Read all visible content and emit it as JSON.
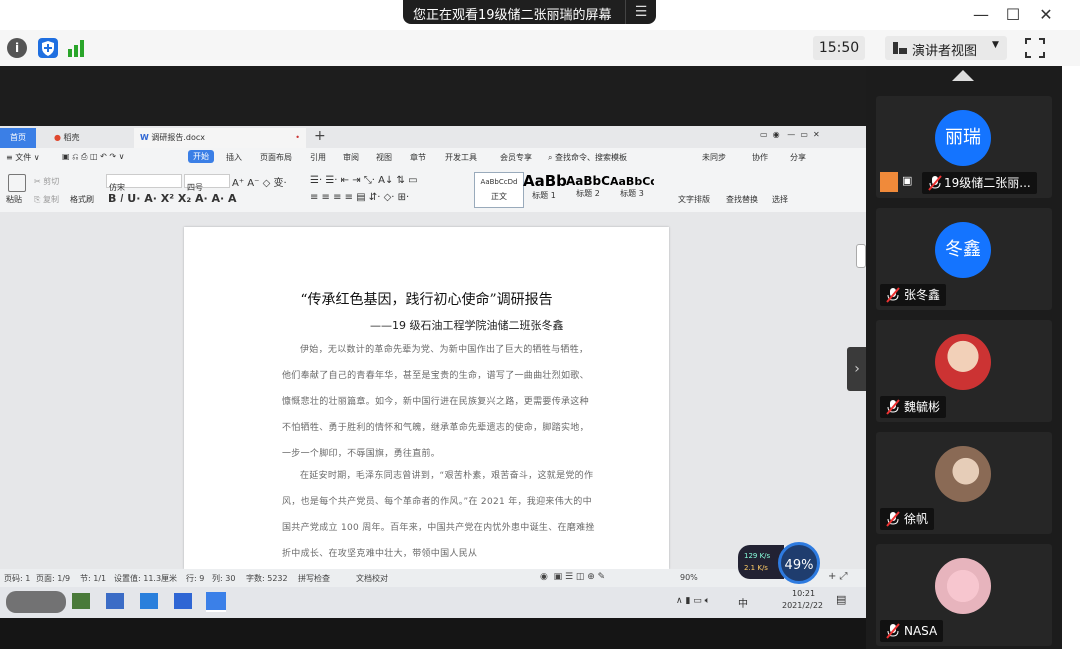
{
  "window": {
    "share_banner": "您正在观看19级储二张丽瑞的屏幕",
    "controls": [
      "—",
      "☐",
      "✕"
    ]
  },
  "toolbar": {
    "time": "15:50",
    "presenter_view": "演讲者视图",
    "icons": [
      "info-icon",
      "shield-icon",
      "signal-icon",
      "fullscreen-icon"
    ]
  },
  "wps": {
    "tabs": {
      "home": "首页",
      "docer": "稻壳",
      "doc": "调研报告.docx"
    },
    "menu": [
      "≡ 文件 ∨",
      "开始",
      "插入",
      "页面布局",
      "引用",
      "审阅",
      "视图",
      "章节",
      "开发工具",
      "会员专享",
      "查找命令、搜索模板",
      "未同步",
      "协作",
      "分享"
    ],
    "ribbon": {
      "paste": "粘贴",
      "cut": "剪切",
      "copy": "复制",
      "format_painter": "格式刷",
      "font": "仿宋",
      "size": "四号",
      "styles": [
        {
          "sample": "AaBbCcDd",
          "name": "正文"
        },
        {
          "sample": "AaBb",
          "name": "标题 1"
        },
        {
          "sample": "AaBbC",
          "name": "标题 2"
        },
        {
          "sample": "AaBbCc",
          "name": "标题 3"
        }
      ],
      "text_layout": "文字排版",
      "find_replace": "查找替换",
      "select": "选择"
    },
    "document": {
      "title": "“传承红色基因，践行初心使命”调研报告",
      "subtitle": "——19 级石油工程学院油储二班张冬鑫",
      "paragraphs": [
        "伊始，无以数计的革命先辈为党、为新中国作出了巨大的牺牲与牺牲，他们奉献了自己的青春年华，甚至是宝贵的生命，谱写了一曲曲壮烈如歌、慷慨悲壮的壮丽篇章。如今，新中国行进在民族复兴之路，更需要传承这种不怕牺牲、勇于胜利的情怀和气魄，继承革命先辈遗志的使命，脚踏实地，一步一个脚印，不辱国旗，勇往直前。",
        "在延安时期，毛泽东同志曾讲到，“艰苦朴素，艰苦奋斗，这就是党的作风，也是每个共产党员、每个革命者的作风。”在 2021 年，我迎来伟大的中国共产党成立 100 周年。百年来，中国共产党在内忧外患中诞生、在磨难挫折中成长、在攻坚克难中壮大，带领中国人民从"
      ]
    },
    "status": [
      "页码: 1",
      "页面: 1/9",
      "节: 1/1",
      "设置值: 11.3厘米",
      "行: 9",
      "列: 30",
      "字数: 5232",
      "拼写检查",
      "文档校对",
      "90%"
    ],
    "taskbar_time": "10:21",
    "taskbar_date": "2021/2/22",
    "taskbar_ime": "中",
    "net_up": "129 K/s",
    "net_down": "2.1 K/s",
    "net_percent": "49%"
  },
  "participants": [
    {
      "avatar": "丽瑞",
      "name": "19级储二张丽...",
      "type": "text",
      "color": "#1474ff"
    },
    {
      "avatar": "冬鑫",
      "name": "张冬鑫",
      "type": "text",
      "color": "#1474ff"
    },
    {
      "avatar": "",
      "name": "魏毓彬",
      "type": "photo",
      "color": "#b33"
    },
    {
      "avatar": "",
      "name": "徐帆",
      "type": "photo",
      "color": "#a88"
    },
    {
      "avatar": "",
      "name": "NASA",
      "type": "photo",
      "color": "#e8b0b8"
    }
  ]
}
